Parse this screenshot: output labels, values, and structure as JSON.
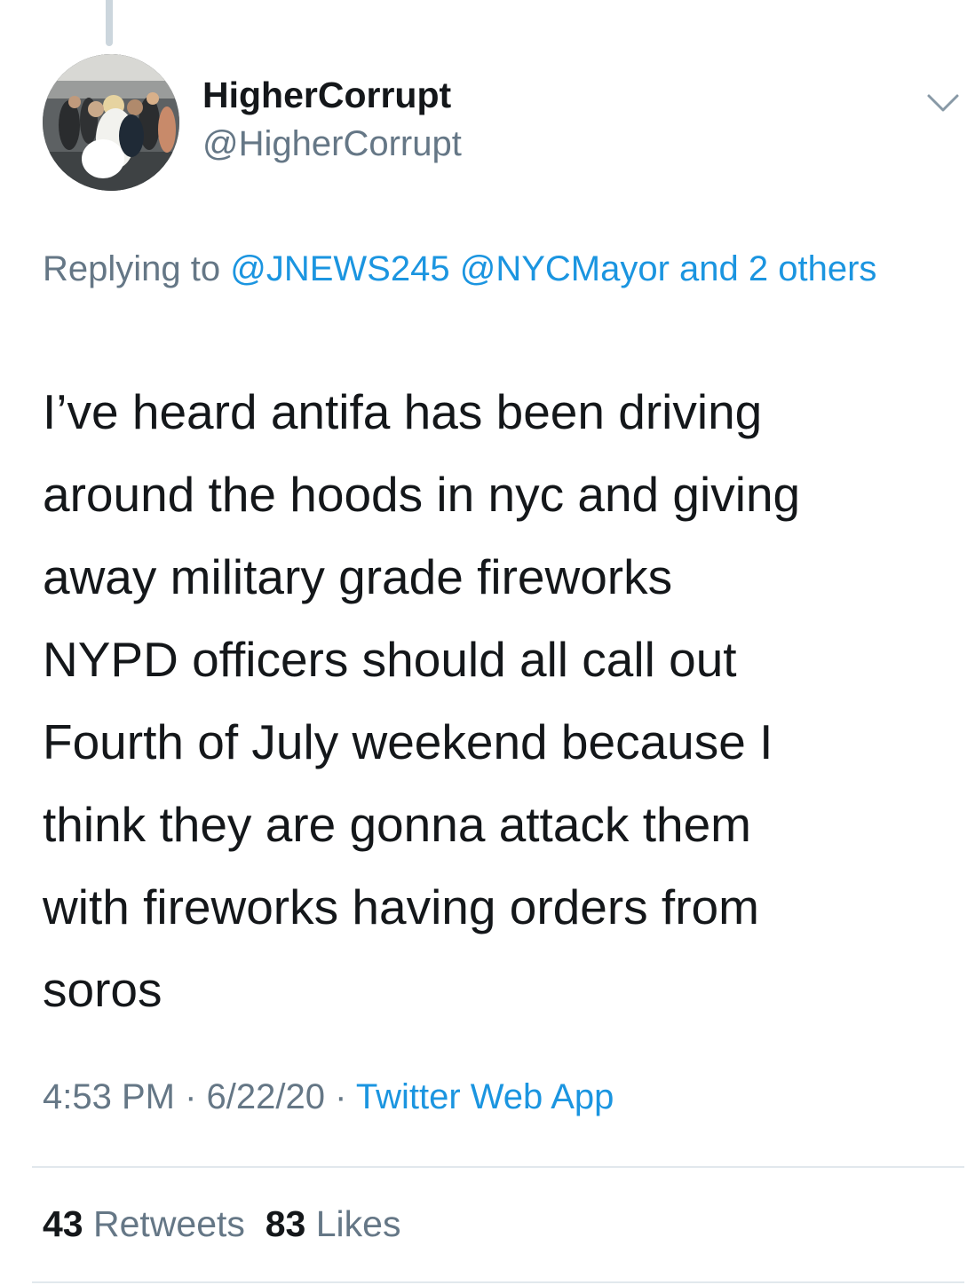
{
  "author": {
    "display_name": "HigherCorrupt",
    "handle": "@HigherCorrupt",
    "avatar_icon": "avatar-photo"
  },
  "reply": {
    "prefix": "Replying to",
    "mention_1": "@JNEWS245",
    "mention_2": "@NYCMayor",
    "mention_more": "and 2 others"
  },
  "tweet": {
    "text": "I’ve heard antifa has been driving\naround the hoods in nyc and giving\naway military grade fireworks\nNYPD officers should all call out\nFourth of July weekend because I\nthink they are gonna attack them\nwith fireworks having orders from\nsoros"
  },
  "meta": {
    "time": "4:53 PM",
    "separator": "·",
    "date": "6/22/20",
    "source": "Twitter Web App"
  },
  "stats": {
    "retweets_count": "43",
    "retweets_label": "Retweets",
    "likes_count": "83",
    "likes_label": "Likes"
  },
  "colors": {
    "link": "#1b95e0",
    "secondary_text": "#657786",
    "primary_text": "#14171a",
    "divider": "#e1e8ed",
    "thread_line": "#ccd6dd"
  }
}
